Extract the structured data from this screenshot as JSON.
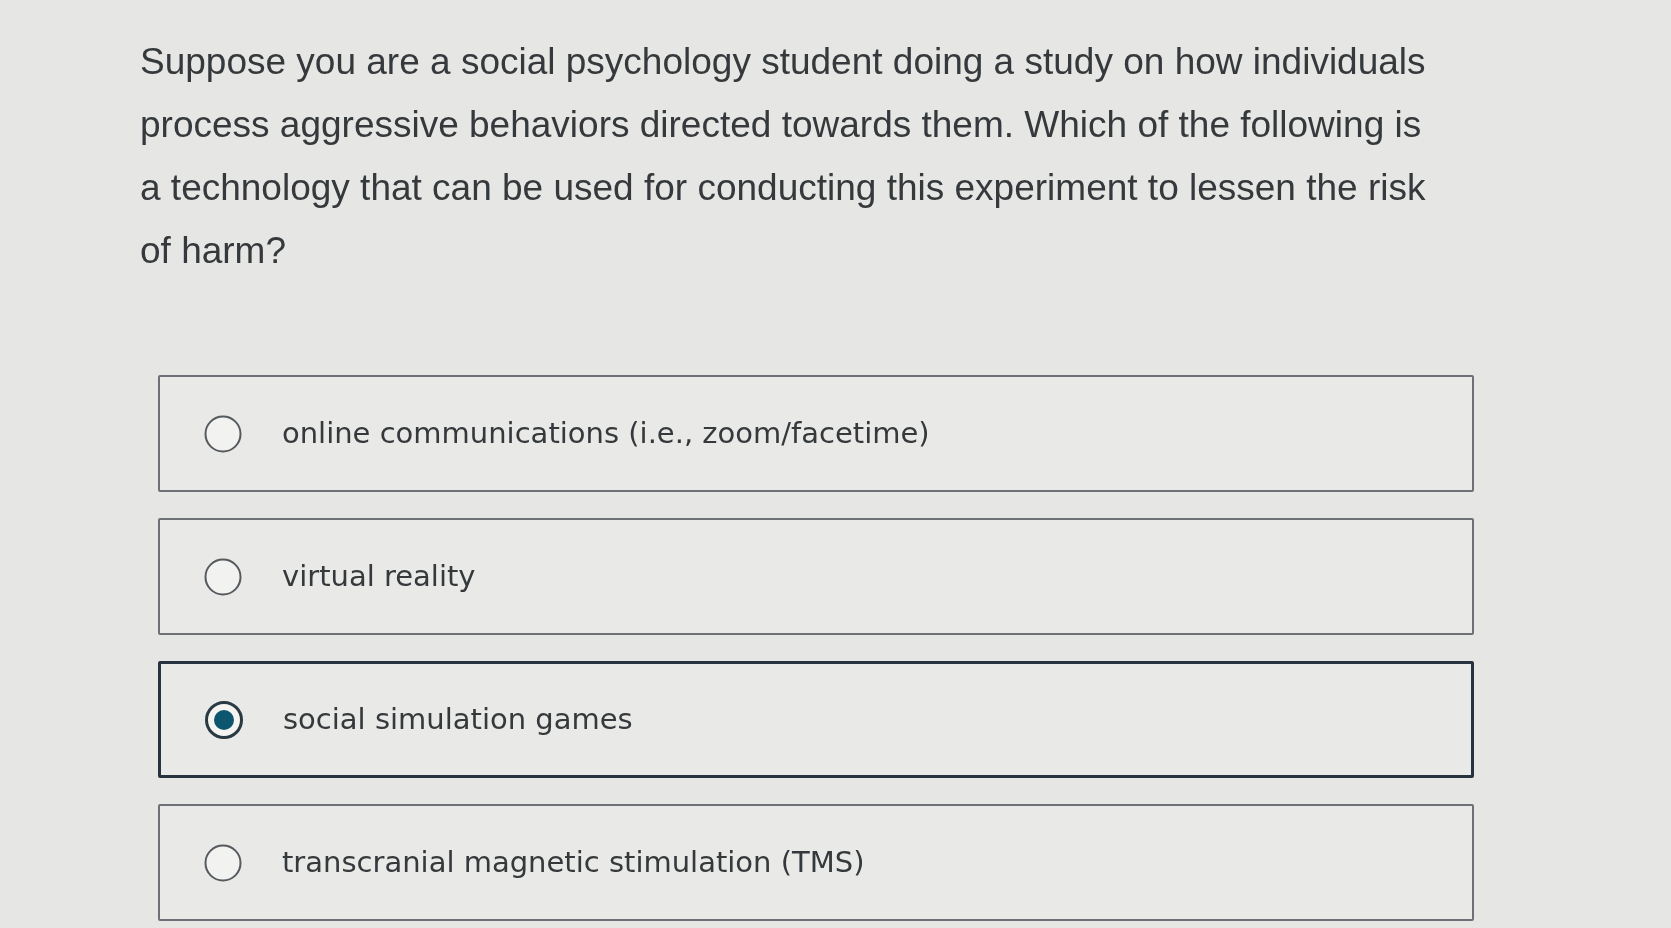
{
  "question": "Suppose you are a social psychology student doing a study on how individuals process aggressive behaviors directed towards them. Which of the following is a technology that can be used for conducting this experiment to lessen the risk of harm?",
  "options": [
    {
      "label": "online communications (i.e., zoom/facetime)",
      "selected": false
    },
    {
      "label": "virtual reality",
      "selected": false
    },
    {
      "label": "social simulation games",
      "selected": true
    },
    {
      "label": "transcranial magnetic stimulation (TMS)",
      "selected": false
    }
  ]
}
